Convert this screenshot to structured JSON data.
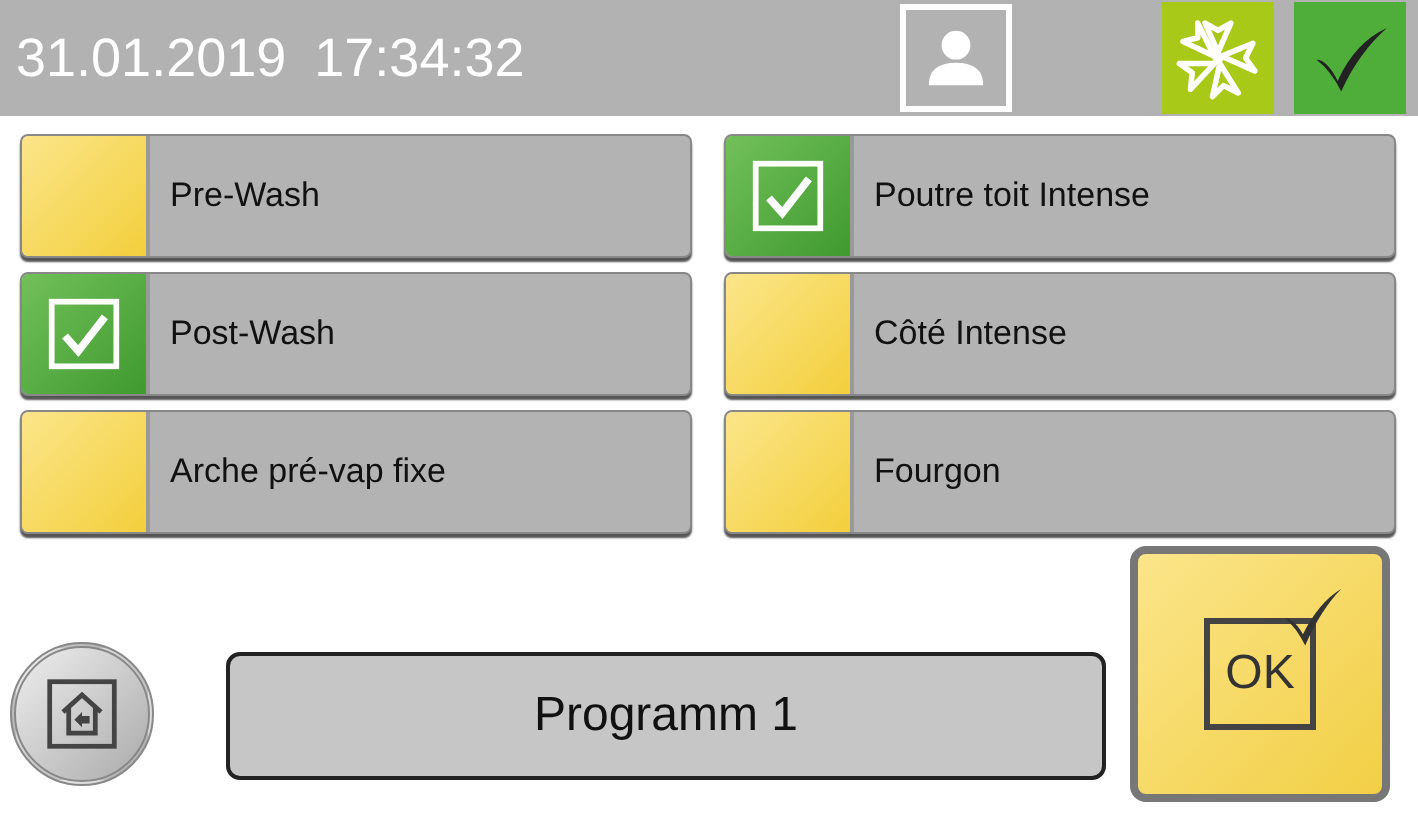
{
  "header": {
    "date": "31.01.2019",
    "time": "17:34:32",
    "status_ok": true
  },
  "options": [
    {
      "label": "Pre-Wash",
      "checked": false
    },
    {
      "label": "Poutre toit Intense",
      "checked": true
    },
    {
      "label": "Post-Wash",
      "checked": true
    },
    {
      "label": "Côté Intense",
      "checked": false
    },
    {
      "label": "Arche pré-vap fixe",
      "checked": false
    },
    {
      "label": "Fourgon",
      "checked": false
    }
  ],
  "program": {
    "name": "Programm 1"
  },
  "ok_button": {
    "label": "OK"
  }
}
